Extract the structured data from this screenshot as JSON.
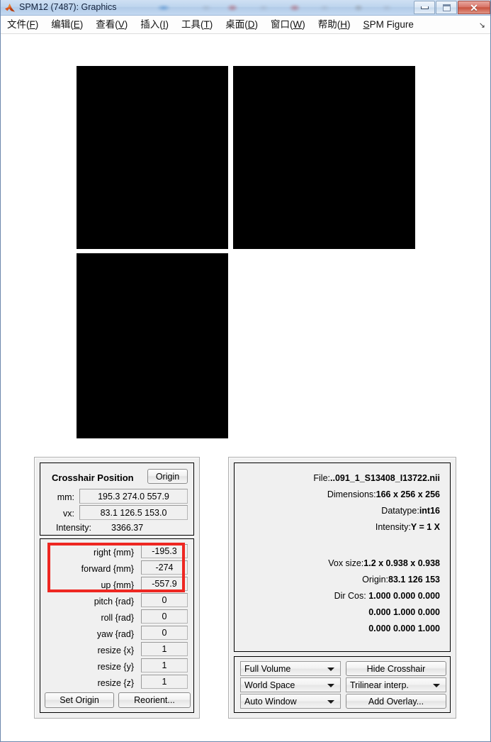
{
  "window": {
    "title": "SPM12 (7487): Graphics",
    "app_icon": "matlab-icon",
    "minimize_label": "",
    "maximize_label": "",
    "close_label": "✕"
  },
  "menubar": {
    "items": [
      {
        "name": "file",
        "pre": "文件(",
        "key": "F",
        "post": ")"
      },
      {
        "name": "edit",
        "pre": "编辑(",
        "key": "E",
        "post": ")"
      },
      {
        "name": "view",
        "pre": "查看(",
        "key": "V",
        "post": ")"
      },
      {
        "name": "insert",
        "pre": "插入(",
        "key": "I",
        "post": ")"
      },
      {
        "name": "tools",
        "pre": "工具(",
        "key": "T",
        "post": ")"
      },
      {
        "name": "desktop",
        "pre": "桌面(",
        "key": "D",
        "post": ")"
      },
      {
        "name": "window",
        "pre": "窗口(",
        "key": "W",
        "post": ")"
      },
      {
        "name": "help",
        "pre": "帮助(",
        "key": "H",
        "post": ")"
      },
      {
        "name": "spm-figure",
        "pre": "",
        "key": "S",
        "post": "PM Figure"
      }
    ],
    "expander": "↘"
  },
  "slices": {
    "sagittal_label": "sagittal-slice",
    "coronal_label": "coronal-slice",
    "axial_label": "axial-slice",
    "color": "#000000"
  },
  "crosshair": {
    "title": "Crosshair Position",
    "origin_button": "Origin",
    "mm_label": "mm:",
    "mm_value": "195.3 274.0 557.9",
    "vx_label": "vx:",
    "vx_value": "83.1 126.5 153.0",
    "intensity_label": "Intensity:",
    "intensity_value": "3366.37"
  },
  "reorient": {
    "rows": [
      {
        "label": "right  {mm}",
        "value": "-195.3",
        "name": "right-mm"
      },
      {
        "label": "forward  {mm}",
        "value": "-274",
        "name": "forward-mm"
      },
      {
        "label": "up  {mm}",
        "value": "-557.9",
        "name": "up-mm"
      },
      {
        "label": "pitch  {rad}",
        "value": "0",
        "name": "pitch-rad"
      },
      {
        "label": "roll  {rad}",
        "value": "0",
        "name": "roll-rad"
      },
      {
        "label": "yaw  {rad}",
        "value": "0",
        "name": "yaw-rad"
      },
      {
        "label": "resize  {x}",
        "value": "1",
        "name": "resize-x"
      },
      {
        "label": "resize  {y}",
        "value": "1",
        "name": "resize-y"
      },
      {
        "label": "resize  {z}",
        "value": "1",
        "name": "resize-z"
      }
    ],
    "set_origin_button": "Set Origin",
    "reorient_button": "Reorient...",
    "highlight_color": "#ee2722"
  },
  "fileinfo": {
    "lines": [
      {
        "key": "File:",
        "value": "..091_1_S13408_I13722.nii",
        "name": "file-name"
      },
      {
        "key": "Dimensions:",
        "value": "166 x 256 x 256",
        "name": "dimensions"
      },
      {
        "key": "Datatype:",
        "value": "int16",
        "name": "datatype"
      },
      {
        "key": "Intensity:",
        "value": "Y = 1 X",
        "name": "intensity-scaling"
      }
    ],
    "lines2": [
      {
        "key": "Vox size:",
        "value": "1.2 x 0.938 x 0.938",
        "name": "vox-size"
      },
      {
        "key": "Origin:",
        "value": "83.1 126 153",
        "name": "origin"
      },
      {
        "key": "Dir Cos: ",
        "value": "1.000  0.000  0.000",
        "name": "dir-cos-row1"
      }
    ],
    "dircos_row2": "0.000  1.000  0.000",
    "dircos_row3": "0.000  0.000  1.000"
  },
  "controls": {
    "volume_select": "Full Volume",
    "space_select": "World Space",
    "window_select": "Auto Window",
    "hide_crosshair_button": "Hide Crosshair",
    "interp_select": "Trilinear interp.",
    "add_overlay_button": "Add Overlay..."
  }
}
